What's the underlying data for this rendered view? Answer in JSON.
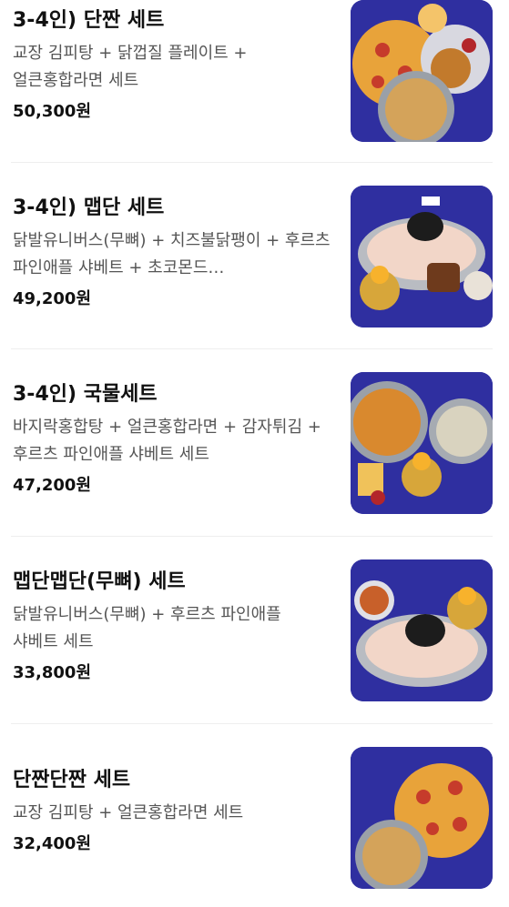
{
  "menu": {
    "items": [
      {
        "name": "3-4인) 단짠 세트",
        "description": "교장 김피탕 + 닭껍질 플레이트 + 얼큰홍합라면 세트",
        "price": "50,300원",
        "image": "set-photo-danjjan"
      },
      {
        "name": "3-4인) 맵단 세트",
        "description": "닭발유니버스(무뼈) + 치즈불닭팽이 + 후르츠 파인애플 샤베트 + 초코몬드…",
        "price": "49,200원",
        "image": "set-photo-maepdan"
      },
      {
        "name": "3-4인) 국물세트",
        "description": "바지락홍합탕 + 얼큰홍합라면 + 감자튀김 + 후르츠 파인애플 샤베트 세트",
        "price": "47,200원",
        "image": "set-photo-soup"
      },
      {
        "name": "맵단맵단(무뼈) 세트",
        "description": "닭발유니버스(무뼈) + 후르츠 파인애플 샤베트 세트",
        "price": "33,800원",
        "image": "set-photo-maepdan-boneless"
      },
      {
        "name": "단짠단짠 세트",
        "description": "교장 김피탕 + 얼큰홍합라면 세트",
        "price": "32,400원",
        "image": "set-photo-danjjan-small"
      }
    ]
  },
  "colors": {
    "image_background": "#2f2fa0",
    "divider": "#eeeeee",
    "description_text": "#555555"
  }
}
